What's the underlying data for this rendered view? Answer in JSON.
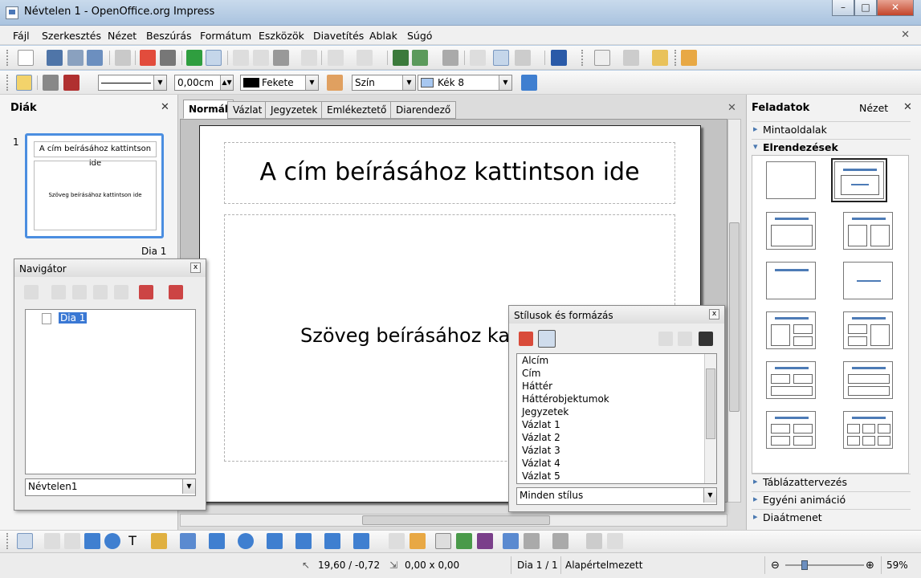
{
  "window": {
    "title": "Névtelen 1 - OpenOffice.org Impress",
    "minimize": "–",
    "maximize": "□",
    "close": "✕"
  },
  "menu": [
    "Fájl",
    "Szerkesztés",
    "Nézet",
    "Beszúrás",
    "Formátum",
    "Eszközök",
    "Diavetítés",
    "Ablak",
    "Súgó"
  ],
  "doc_close": "✕",
  "line_toolbar": {
    "line_width": "0,00cm",
    "line_color": "Fekete",
    "area_type": "Szín",
    "area_color": "Kék 8"
  },
  "slides_pane": {
    "title": "Diák",
    "close": "✕",
    "slide_number": "1",
    "slide_name": "Dia 1",
    "thumb_title": "A cím beírásához kattintson ide",
    "thumb_body": "Szöveg beírásához kattintson ide"
  },
  "tabs": [
    "Normál",
    "Vázlat",
    "Jegyzetek",
    "Emlékeztető",
    "Diarendező"
  ],
  "slide": {
    "title": "A cím beírásához kattintson ide",
    "body": "Szöveg beírásához kattintson ide"
  },
  "task_pane": {
    "title": "Feladatok",
    "view_menu": "Nézet",
    "close": "✕",
    "sections": [
      "Mintaoldalak",
      "Elrendezések",
      "Táblázattervezés",
      "Egyéni animáció",
      "Diaátmenet"
    ]
  },
  "navigator": {
    "title": "Navigátor",
    "close": "x",
    "tree_item": "Dia 1",
    "document": "Névtelen1"
  },
  "styles": {
    "title": "Stílusok és formázás",
    "close": "x",
    "items": [
      "Alcím",
      "Cím",
      "Háttér",
      "Háttérobjektumok",
      "Jegyzetek",
      "Vázlat 1",
      "Vázlat 2",
      "Vázlat 3",
      "Vázlat 4",
      "Vázlat 5"
    ],
    "filter": "Minden stílus"
  },
  "statusbar": {
    "position": "19,60 / -0,72",
    "size": "0,00 x 0,00",
    "slide": "Dia 1 / 1",
    "layout": "Alapértelmezett",
    "zoom": "59%"
  },
  "colors": {
    "accent": "#4b8ee0",
    "line_color": "#000000",
    "area_color": "#a7c7f0"
  }
}
